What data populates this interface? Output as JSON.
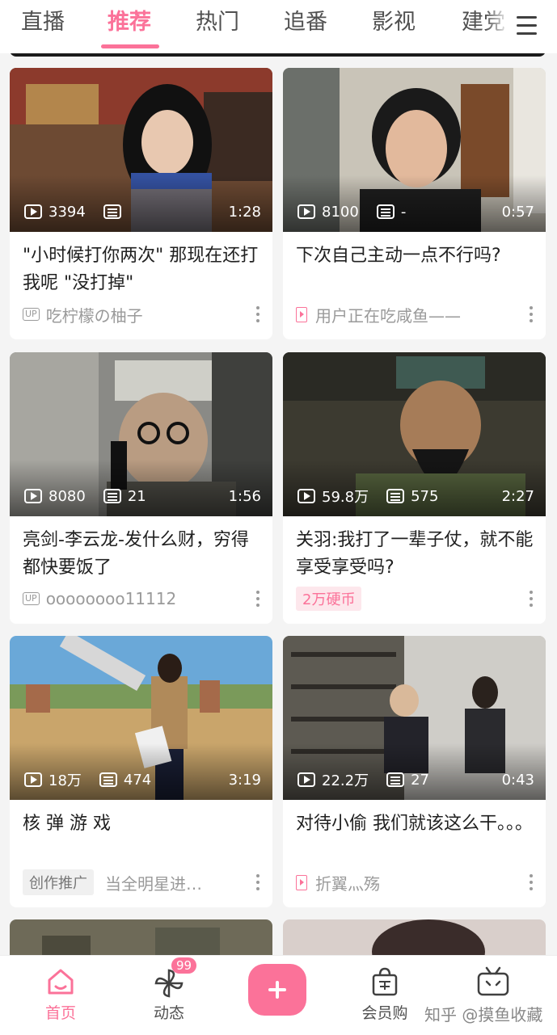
{
  "tabs": [
    {
      "label": "直播"
    },
    {
      "label": "推荐"
    },
    {
      "label": "热门"
    },
    {
      "label": "追番"
    },
    {
      "label": "影视"
    },
    {
      "label": "建党"
    }
  ],
  "cards": [
    {
      "plays": "3394",
      "danmaku": "",
      "duration": "1:28",
      "title": "\"小时候打你两次\" 那现在还打我呢 \"没打掉\"",
      "badge": "UP",
      "author": "吃柠檬の柚子"
    },
    {
      "plays": "8100",
      "danmaku": "-",
      "duration": "0:57",
      "title": "下次自己主动一点不行吗?",
      "author": "用户正在吃咸鱼——"
    },
    {
      "plays": "8080",
      "danmaku": "21",
      "duration": "1:56",
      "title": "亮剑-李云龙-发什么财，穷得都快要饭了",
      "badge": "UP",
      "author": "oooooooo11112"
    },
    {
      "plays": "59.8万",
      "danmaku": "575",
      "duration": "2:27",
      "title": "关羽:我打了一辈子仗，就不能享受享受吗?",
      "coins": "2万硬币"
    },
    {
      "plays": "18万",
      "danmaku": "474",
      "duration": "3:19",
      "title": "核 弹 游 戏",
      "promo": "创作推广",
      "author": "当全明星进…"
    },
    {
      "plays": "22.2万",
      "danmaku": "27",
      "duration": "0:43",
      "title": "对待小偷 我们就该这么干。。。",
      "author": "折翼灬殇"
    }
  ],
  "nav": {
    "home": "首页",
    "dynamic": "动态",
    "dynamic_badge": "99",
    "shop": "会员购"
  },
  "watermark": "知乎 @摸鱼收藏",
  "colors": {
    "accent": "#fb7299",
    "background": "#f4f4f4",
    "text": "#212121",
    "muted": "#9a9a9a"
  },
  "icons": [
    "menu-icon",
    "play-count-icon",
    "danmaku-icon",
    "more-icon",
    "home-icon",
    "pinwheel-icon",
    "plus-icon",
    "shopping-bag-icon",
    "tv-icon"
  ]
}
